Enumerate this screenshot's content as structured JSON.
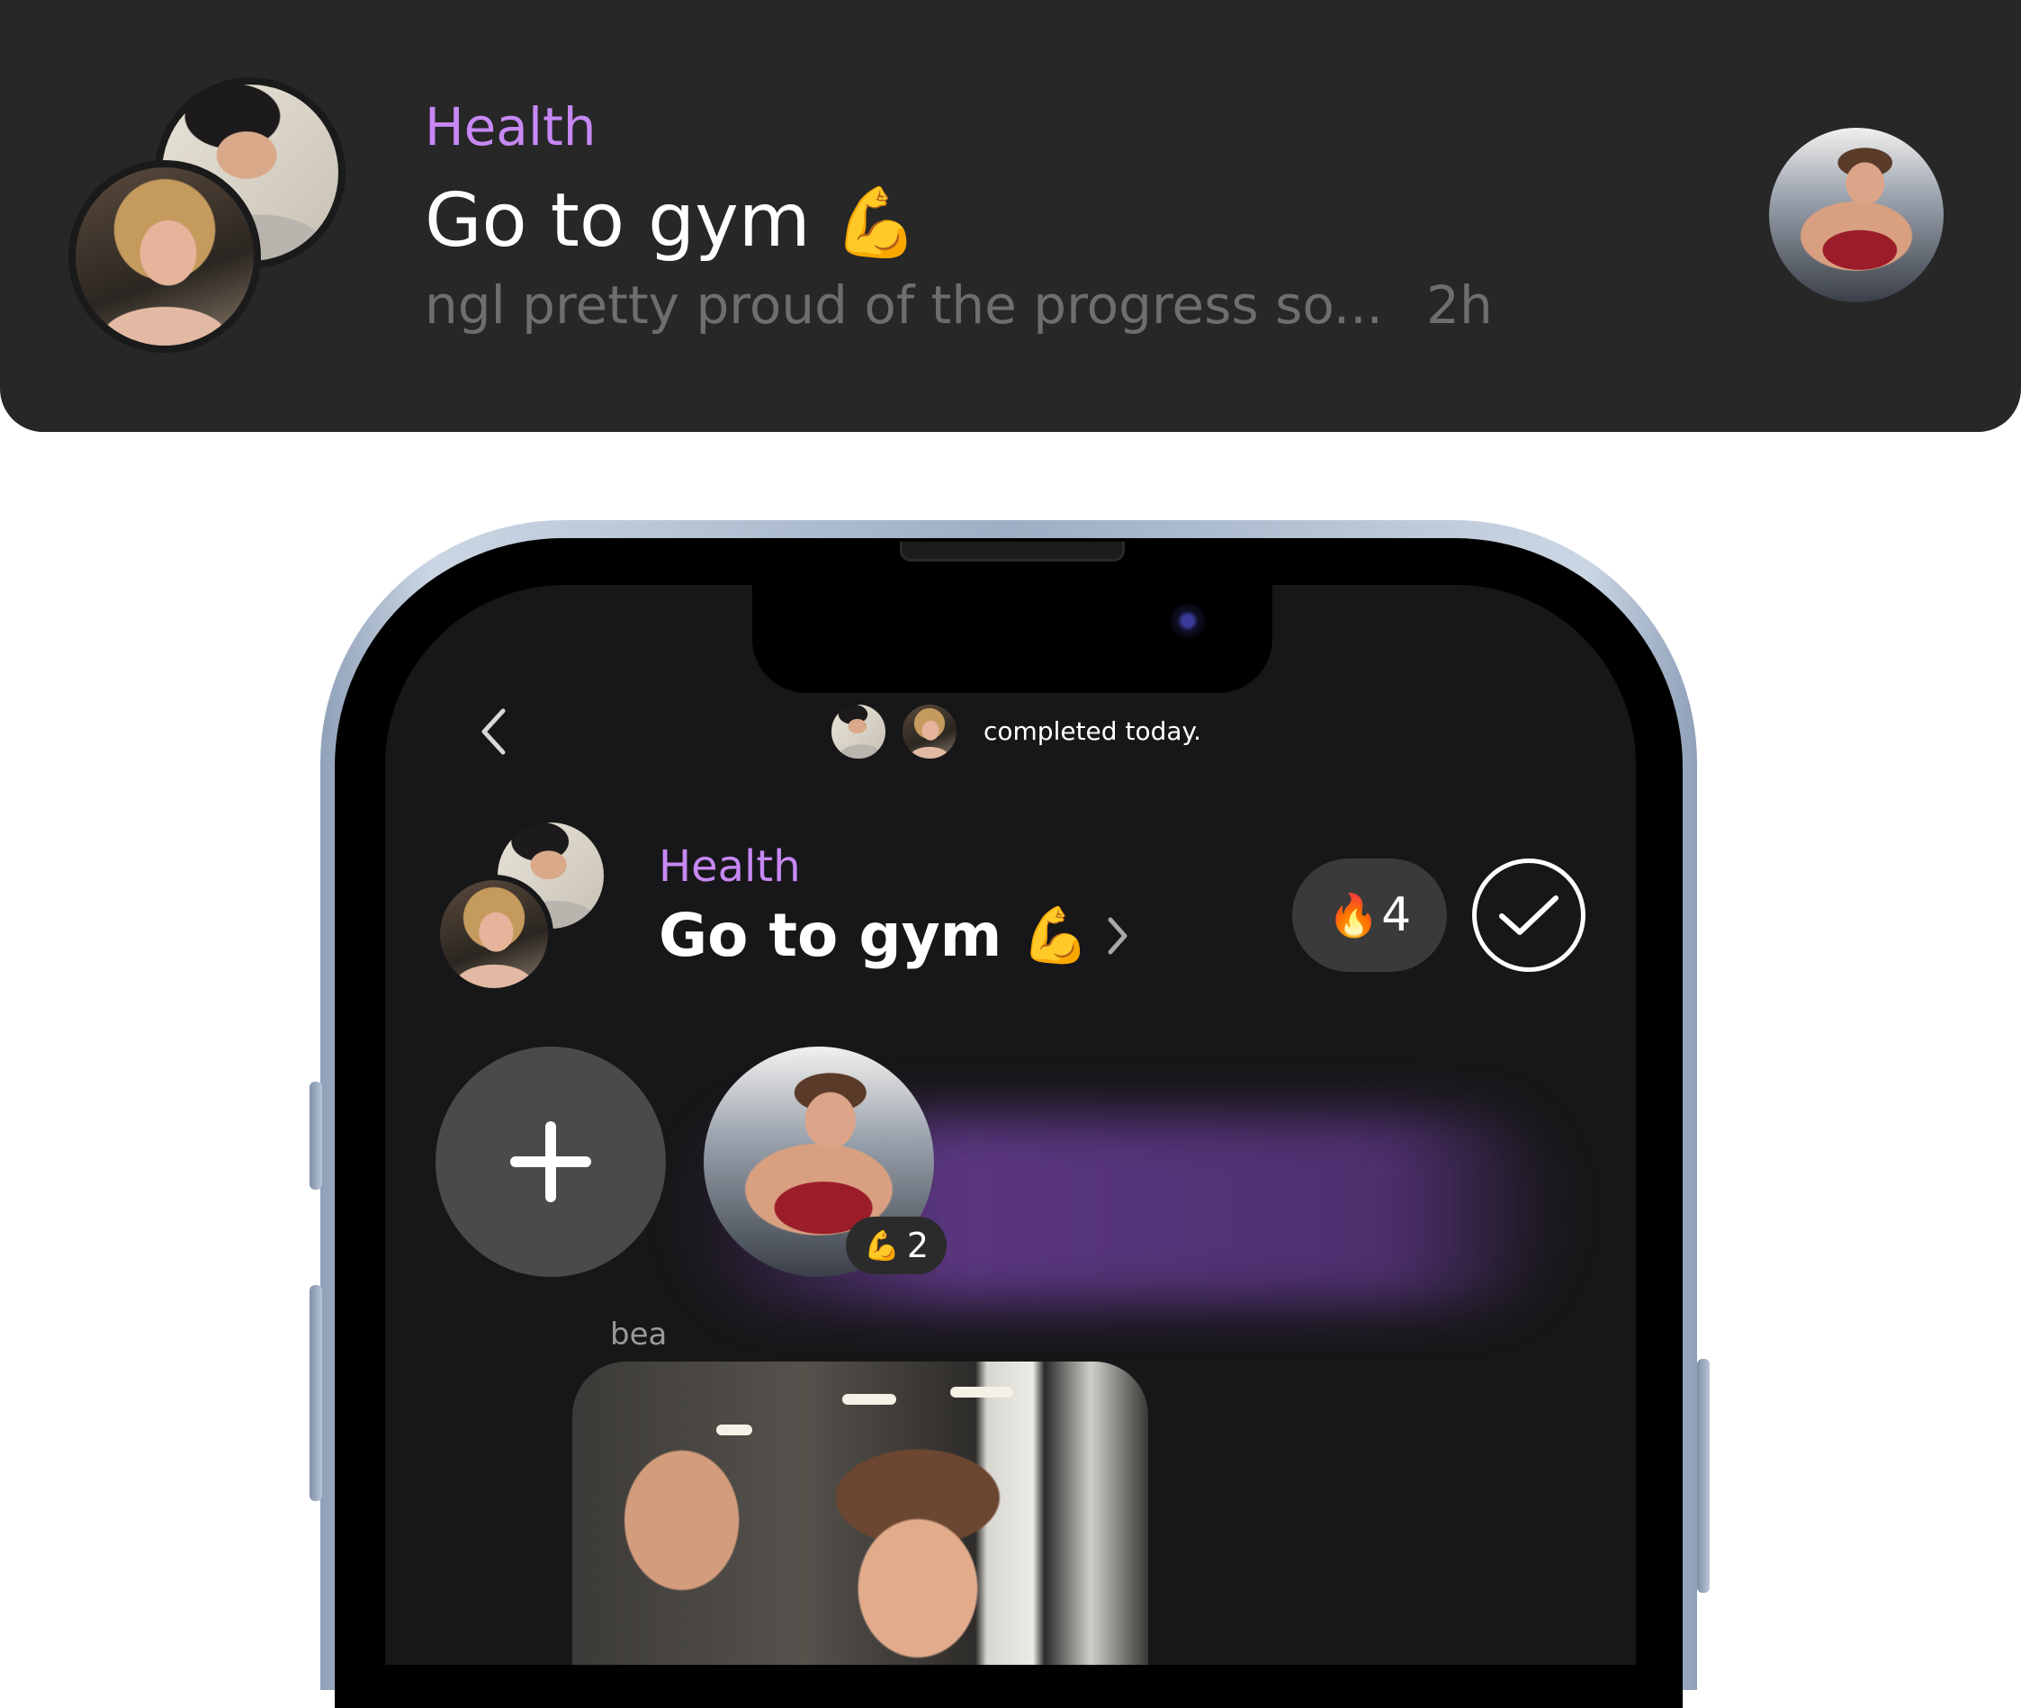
{
  "notification": {
    "category": "Health",
    "title": "Go to gym",
    "title_emoji": "💪",
    "preview": "ngl pretty proud of the progress so...",
    "time": "2h"
  },
  "screen": {
    "header": {
      "completed_text": "completed today."
    },
    "habit": {
      "category": "Health",
      "title": "Go to gym",
      "title_emoji": "💪",
      "streak_emoji": "🔥",
      "streak_count": "4"
    },
    "post": {
      "reaction_emoji": "💪",
      "reaction_count": "2",
      "author": "bea"
    }
  },
  "colors": {
    "accent_purple": "#c788f4",
    "card_bg": "#272727",
    "screen_bg": "#171719",
    "muted_text": "#6e6e6e"
  },
  "icons": [
    "back-chevron-icon",
    "chevron-right-icon",
    "check-icon",
    "plus-icon",
    "fire-icon",
    "flexed-biceps-icon"
  ]
}
